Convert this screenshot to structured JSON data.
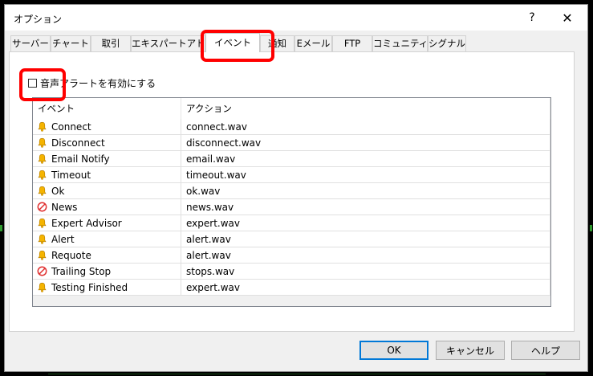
{
  "window": {
    "title": "オプション",
    "help_label": "?",
    "close_label": "✕"
  },
  "tabs": [
    {
      "label": "サーバー"
    },
    {
      "label": "チャート"
    },
    {
      "label": "取引"
    },
    {
      "label": "エキスパートアドバイザ"
    },
    {
      "label": "イベント",
      "active": true
    },
    {
      "label": "通知"
    },
    {
      "label": "Eメール"
    },
    {
      "label": "FTP"
    },
    {
      "label": "コミュニティー"
    },
    {
      "label": "シグナル"
    }
  ],
  "sound_alert": {
    "label": "音声アラートを有効にする",
    "checked": false
  },
  "events_table": {
    "columns": [
      "イベント",
      "アクション"
    ],
    "rows": [
      {
        "event": "Connect",
        "action": "connect.wav",
        "icon": "bell-icon"
      },
      {
        "event": "Disconnect",
        "action": "disconnect.wav",
        "icon": "bell-icon"
      },
      {
        "event": "Email Notify",
        "action": "email.wav",
        "icon": "bell-icon"
      },
      {
        "event": "Timeout",
        "action": "timeout.wav",
        "icon": "bell-icon"
      },
      {
        "event": "Ok",
        "action": "ok.wav",
        "icon": "bell-icon"
      },
      {
        "event": "News",
        "action": "news.wav",
        "icon": "disabled-icon"
      },
      {
        "event": "Expert Advisor",
        "action": "expert.wav",
        "icon": "bell-icon"
      },
      {
        "event": "Alert",
        "action": "alert.wav",
        "icon": "bell-icon"
      },
      {
        "event": "Requote",
        "action": "alert.wav",
        "icon": "bell-icon"
      },
      {
        "event": "Trailing Stop",
        "action": "stops.wav",
        "icon": "disabled-icon"
      },
      {
        "event": "Testing Finished",
        "action": "expert.wav",
        "icon": "bell-icon"
      }
    ]
  },
  "buttons": {
    "ok": "OK",
    "cancel": "キャンセル",
    "help": "ヘルプ"
  },
  "colors": {
    "highlight": "#ff0000",
    "bell": "#f5b400",
    "disabled": "#e03030",
    "default_button_border": "#0078d7"
  }
}
